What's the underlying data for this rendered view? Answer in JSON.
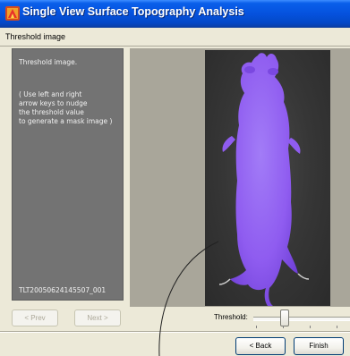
{
  "window": {
    "title": "Single View Surface Topography Analysis",
    "step_header": "Threshold image"
  },
  "instructions": {
    "line1": "Threshold image.",
    "line2": "( Use left and right",
    "line3": "arrow keys to nudge",
    "line4": "the threshold value",
    "line5": "to generate a mask image )"
  },
  "filename": "TLT20050624145507_001",
  "nav": {
    "prev_label": "< Prev",
    "next_label": "Next >"
  },
  "threshold": {
    "label": "Threshold:",
    "value_fraction": 0.3
  },
  "footer": {
    "back_label": "< Back",
    "finish_label": "Finish"
  },
  "colors": {
    "mask": "#8f5cf0",
    "title_bar": "#0552de"
  },
  "icons": {
    "app": "app-logo-icon"
  }
}
